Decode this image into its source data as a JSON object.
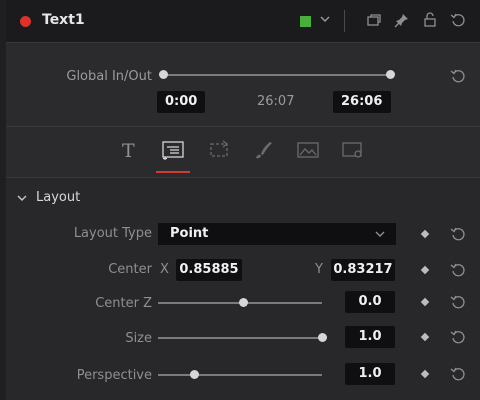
{
  "header": {
    "title": "Text1",
    "color_swatch": "#48b03a",
    "icons": [
      "color-dropdown-icon",
      "duplicate-icon",
      "pin-icon",
      "lock-icon",
      "reset-icon"
    ]
  },
  "global_in_out": {
    "label": "Global In/Out",
    "in_value": "0:00",
    "duration": "26:07",
    "out_value": "26:06"
  },
  "tabs": {
    "items": [
      {
        "name": "text-tab",
        "icon": "T"
      },
      {
        "name": "layout-tab",
        "active": true
      },
      {
        "name": "transform-tab"
      },
      {
        "name": "shading-tab"
      },
      {
        "name": "image-tab"
      },
      {
        "name": "settings-tab"
      }
    ]
  },
  "layout": {
    "section_title": "Layout",
    "layout_type_label": "Layout Type",
    "layout_type_value": "Point",
    "center_label": "Center",
    "center_x_label": "X",
    "center_x": "0.85885",
    "center_y_label": "Y",
    "center_y": "0.83217",
    "center_z_label": "Center Z",
    "center_z": "0.0",
    "center_z_slider_fraction": 0.52,
    "size_label": "Size",
    "size": "1.0",
    "size_slider_fraction": 1.0,
    "perspective_label": "Perspective",
    "perspective": "1.0",
    "perspective_slider_fraction": 0.22
  }
}
